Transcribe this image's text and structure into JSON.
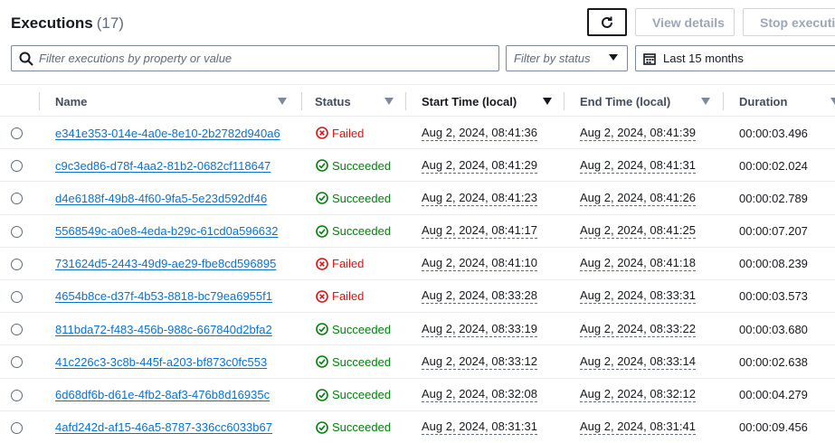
{
  "header": {
    "title": "Executions",
    "count": "(17)",
    "refresh_icon": "refresh-icon",
    "view_details_label": "View details",
    "stop_label": "Stop execution"
  },
  "filters": {
    "search_placeholder": "Filter executions by property or value",
    "status_placeholder": "Filter by status",
    "date_value": "Last 15 months"
  },
  "columns": {
    "name": "Name",
    "status": "Status",
    "start": "Start Time (local)",
    "end": "End Time (local)",
    "duration": "Duration"
  },
  "rows": [
    {
      "name": "e341e353-014e-4a0e-8e10-2b2782d940a6",
      "status": "Failed",
      "start": "Aug 2, 2024, 08:41:36",
      "end": "Aug 2, 2024, 08:41:39",
      "duration": "00:00:03.496"
    },
    {
      "name": "c9c3ed86-d78f-4aa2-81b2-0682cf118647",
      "status": "Succeeded",
      "start": "Aug 2, 2024, 08:41:29",
      "end": "Aug 2, 2024, 08:41:31",
      "duration": "00:00:02.024"
    },
    {
      "name": "d4e6188f-49b8-4f60-9fa5-5e23d592df46",
      "status": "Succeeded",
      "start": "Aug 2, 2024, 08:41:23",
      "end": "Aug 2, 2024, 08:41:26",
      "duration": "00:00:02.789"
    },
    {
      "name": "5568549c-a0e8-4eda-b29c-61cd0a596632",
      "status": "Succeeded",
      "start": "Aug 2, 2024, 08:41:17",
      "end": "Aug 2, 2024, 08:41:25",
      "duration": "00:00:07.207"
    },
    {
      "name": "731624d5-2443-49d9-ae29-fbe8cd596895",
      "status": "Failed",
      "start": "Aug 2, 2024, 08:41:10",
      "end": "Aug 2, 2024, 08:41:18",
      "duration": "00:00:08.239"
    },
    {
      "name": "4654b8ce-d37f-4b53-8818-bc79ea6955f1",
      "status": "Failed",
      "start": "Aug 2, 2024, 08:33:28",
      "end": "Aug 2, 2024, 08:33:31",
      "duration": "00:00:03.573"
    },
    {
      "name": "811bda72-f483-456b-988c-667840d2bfa2",
      "status": "Succeeded",
      "start": "Aug 2, 2024, 08:33:19",
      "end": "Aug 2, 2024, 08:33:22",
      "duration": "00:00:03.680"
    },
    {
      "name": "41c226c3-3c8b-445f-a203-bf873c0fc553",
      "status": "Succeeded",
      "start": "Aug 2, 2024, 08:33:12",
      "end": "Aug 2, 2024, 08:33:14",
      "duration": "00:00:02.638"
    },
    {
      "name": "6d68df6b-d61e-4fb2-8af3-476b8d16935c",
      "status": "Succeeded",
      "start": "Aug 2, 2024, 08:32:08",
      "end": "Aug 2, 2024, 08:32:12",
      "duration": "00:00:04.279"
    },
    {
      "name": "4afd242d-af15-46a5-8787-336cc6033b67",
      "status": "Succeeded",
      "start": "Aug 2, 2024, 08:31:31",
      "end": "Aug 2, 2024, 08:31:41",
      "duration": "00:00:09.456"
    }
  ],
  "colors": {
    "link": "#0972d3",
    "success": "#037f0c",
    "error": "#d91515"
  }
}
